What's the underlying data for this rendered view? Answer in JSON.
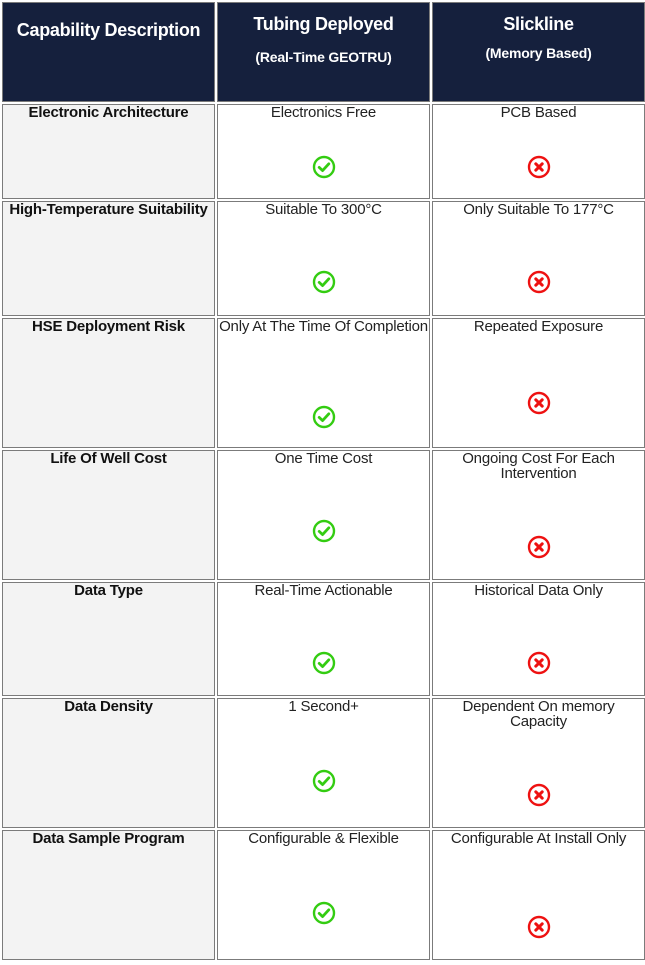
{
  "colors": {
    "header_bg": "#15203d",
    "header_text": "#ffffff",
    "capability_bg": "#f3f3f3",
    "check_green": "#33cc11",
    "cross_red": "#ee1111",
    "border": "#7b7b7b"
  },
  "header": {
    "capability": "Capability Description",
    "tubing_title": "Tubing Deployed",
    "tubing_subtitle": "(Real-Time GEOTRU)",
    "slickline_title": "Slickline",
    "slickline_subtitle": "(Memory Based)"
  },
  "rows": [
    {
      "capability": "Electronic Architecture",
      "tubing": "Electronics Free",
      "tubing_icon": "check-circle-icon",
      "slickline": "PCB Based",
      "slickline_icon": "x-circle-icon"
    },
    {
      "capability": "High-Temperature Suitability",
      "tubing": "Suitable To 300°C",
      "tubing_icon": "check-circle-icon",
      "slickline": "Only Suitable To 177°C",
      "slickline_icon": "x-circle-icon"
    },
    {
      "capability": "HSE Deployment Risk",
      "tubing": "Only At The Time Of Completion",
      "tubing_icon": "check-circle-icon",
      "slickline": "Repeated Exposure",
      "slickline_icon": "x-circle-icon"
    },
    {
      "capability": "Life Of Well Cost",
      "tubing": "One Time Cost",
      "tubing_icon": "check-circle-icon",
      "slickline": "Ongoing Cost For Each Intervention",
      "slickline_icon": "x-circle-icon"
    },
    {
      "capability": "Data Type",
      "tubing": "Real-Time Actionable",
      "tubing_icon": "check-circle-icon",
      "slickline": "Historical Data Only",
      "slickline_icon": "x-circle-icon"
    },
    {
      "capability": "Data Density",
      "tubing": "1 Second+",
      "tubing_icon": "check-circle-icon",
      "slickline": "Dependent On memory Capacity",
      "slickline_icon": "x-circle-icon"
    },
    {
      "capability": "Data Sample Program",
      "tubing": "Configurable & Flexible",
      "tubing_icon": "check-circle-icon",
      "slickline": "Configurable At Install Only",
      "slickline_icon": "x-circle-icon"
    }
  ]
}
